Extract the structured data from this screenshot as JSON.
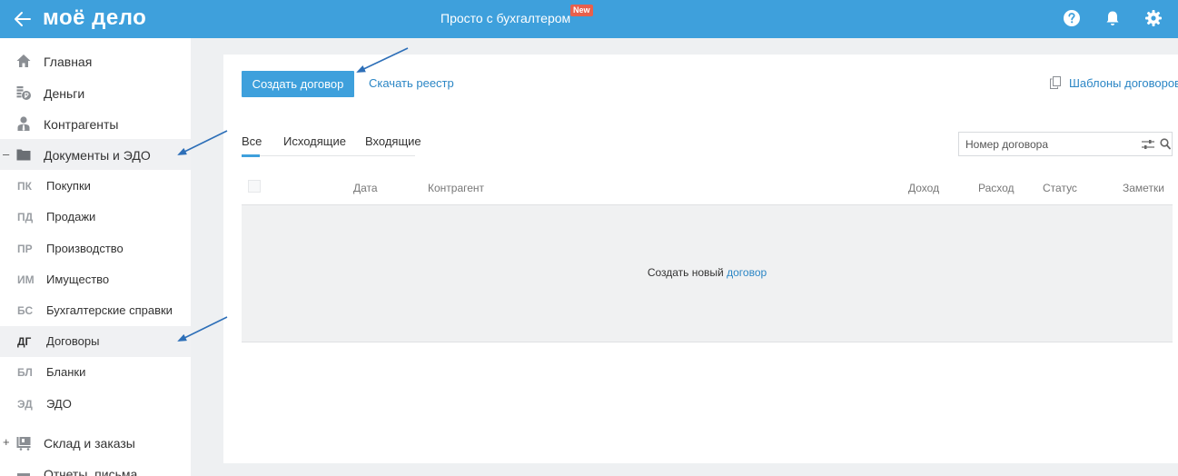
{
  "header": {
    "logo": "моё дело",
    "promo": "Просто с бухгалтером",
    "promo_badge": "New"
  },
  "sidebar": {
    "items": [
      {
        "label": "Главная",
        "icon": "home-icon"
      },
      {
        "label": "Деньги",
        "icon": "money-icon"
      },
      {
        "label": "Контрагенты",
        "icon": "contractor-icon"
      },
      {
        "label": "Документы и ЭДО",
        "icon": "folder-icon",
        "toggle": "–"
      },
      {
        "label": "Склад и заказы",
        "icon": "warehouse-icon",
        "toggle": "+"
      },
      {
        "label": "Отчеты, письма",
        "icon": "reports-icon"
      }
    ],
    "sub_items": [
      {
        "abbr": "ПК",
        "label": "Покупки"
      },
      {
        "abbr": "ПД",
        "label": "Продажи"
      },
      {
        "abbr": "ПР",
        "label": "Производство"
      },
      {
        "abbr": "ИМ",
        "label": "Имущество"
      },
      {
        "abbr": "БС",
        "label": "Бухгалтерские справки"
      },
      {
        "abbr": "ДГ",
        "label": "Договоры"
      },
      {
        "abbr": "БЛ",
        "label": "Бланки"
      },
      {
        "abbr": "ЭД",
        "label": "ЭДО"
      }
    ]
  },
  "main": {
    "create_button": "Создать договор",
    "download_link": "Скачать реестр",
    "templates_link": "Шаблоны договоров",
    "tabs": [
      {
        "label": "Все"
      },
      {
        "label": "Исходящие"
      },
      {
        "label": "Входящие"
      }
    ],
    "search_placeholder": "Номер договора",
    "columns": [
      "Дата",
      "Контрагент",
      "Доход",
      "Расход",
      "Статус",
      "Заметки"
    ],
    "empty_text": "Создать новый",
    "empty_link": "договор"
  },
  "colors": {
    "accent": "#3ea0dc",
    "link": "#2b86c5",
    "badge": "#e8604c"
  }
}
